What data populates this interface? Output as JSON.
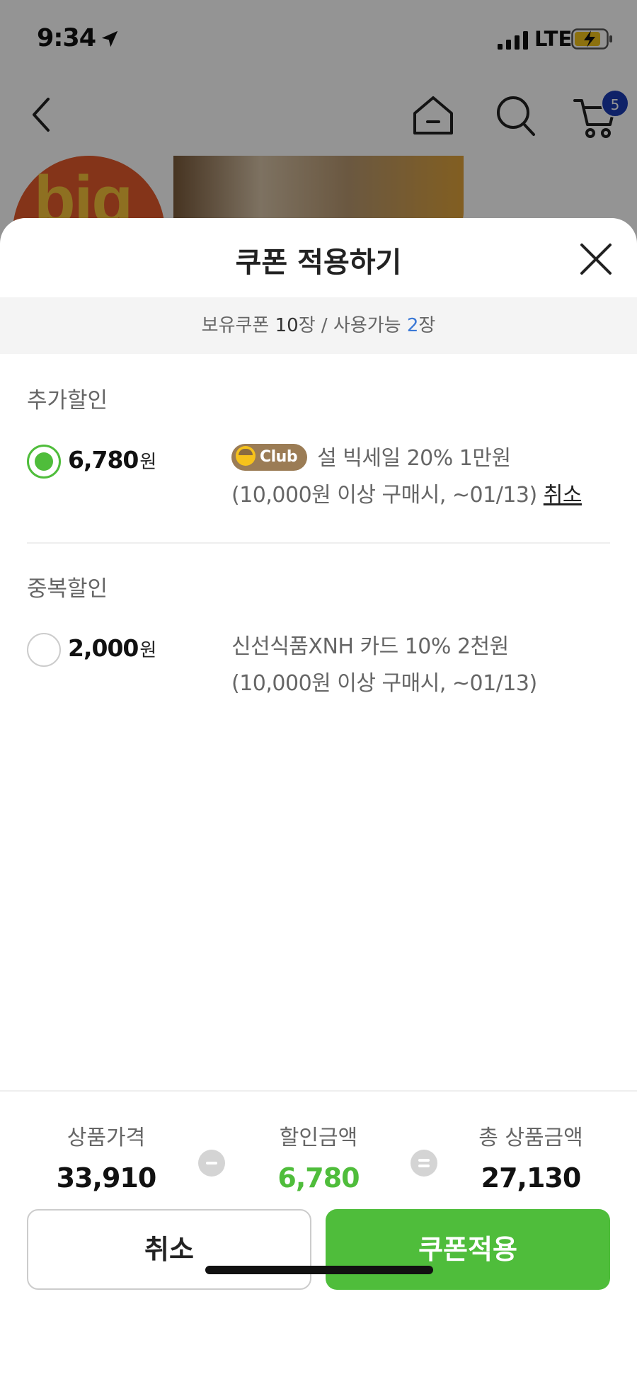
{
  "status_bar": {
    "time": "9:34",
    "network": "LTE"
  },
  "nav": {
    "cart_count": "5"
  },
  "hero": {
    "brand_text": "big"
  },
  "sheet": {
    "title": "쿠폰 적용하기",
    "summary": {
      "owned_label": "보유쿠폰 ",
      "owned_count": "10",
      "owned_unit": "장 / 사용가능 ",
      "usable_count": "2",
      "usable_unit": "장"
    },
    "sections": [
      {
        "title": "추가할인",
        "coupon": {
          "selected": true,
          "amount": "6,780",
          "unit": "원",
          "badge": "Club",
          "line1": "설 빅세일 20% 1만원",
          "line2": "(10,000원 이상 구매시, ~01/13)",
          "cancel_label": "취소"
        }
      },
      {
        "title": "중복할인",
        "coupon": {
          "selected": false,
          "amount": "2,000",
          "unit": "원",
          "line1": "신선식품XNH 카드 10% 2천원",
          "line2": "(10,000원 이상 구매시, ~01/13)"
        }
      }
    ]
  },
  "totals": {
    "price_label": "상품가격",
    "price_value": "33,910",
    "discount_label": "할인금액",
    "discount_value": "6,780",
    "total_label": "총 상품금액",
    "total_value": "27,130"
  },
  "buttons": {
    "cancel": "취소",
    "apply": "쿠폰적용"
  },
  "colors": {
    "accent_green": "#4fbd3b",
    "badge_blue": "#1a3bb3",
    "highlight_blue": "#3a78d6",
    "club_brown": "#9b7c55"
  }
}
